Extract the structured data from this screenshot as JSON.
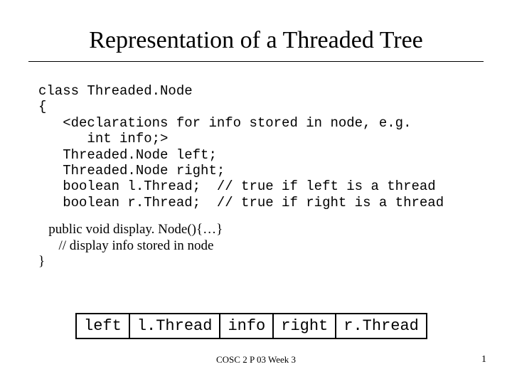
{
  "title": "Representation of a Threaded Tree",
  "code": {
    "l1": "class Threaded.Node",
    "l2": "{",
    "l3": "   <declarations for info stored in node, e.g.",
    "l4": "      int info;>",
    "l5": "   Threaded.Node left;",
    "l6": "   Threaded.Node right;",
    "l7": "   boolean l.Thread;  // true if left is a thread",
    "l8": "   boolean r.Thread;  // true if right is a thread"
  },
  "method": {
    "l1": "   public void display. Node(){…}",
    "l2": "      // display info stored in node",
    "l3": "}"
  },
  "cells": {
    "c1": "left",
    "c2": "l.Thread",
    "c3": "info",
    "c4": "right",
    "c5": "r.Thread"
  },
  "footer": "COSC 2 P 03 Week 3",
  "page": "1"
}
